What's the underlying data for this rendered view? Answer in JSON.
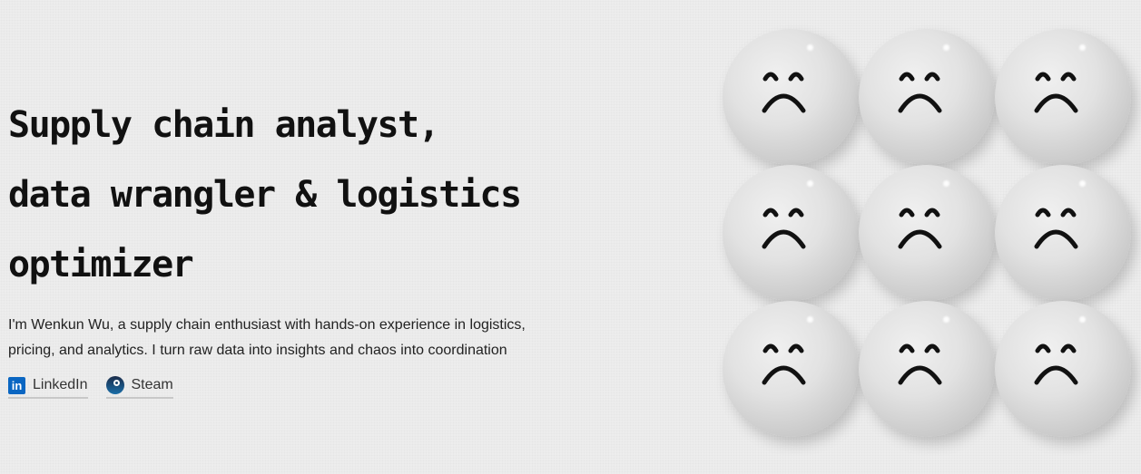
{
  "hero": {
    "heading_lines": [
      "Supply chain analyst,",
      "data wrangler & logistics",
      "optimizer"
    ],
    "description": "I'm Wenkun Wu, a supply chain enthusiast with hands-on experience in logistics, pricing, and analytics. I turn raw data into insights and chaos into coordination",
    "links": [
      {
        "label": "LinkedIn",
        "icon": "linkedin-icon"
      },
      {
        "label": "Steam",
        "icon": "steam-icon"
      }
    ]
  },
  "faces": {
    "count": 9,
    "expression": "sad-face-icon"
  },
  "colors": {
    "linkedin": "#0a66c2",
    "background": "#ededed"
  }
}
